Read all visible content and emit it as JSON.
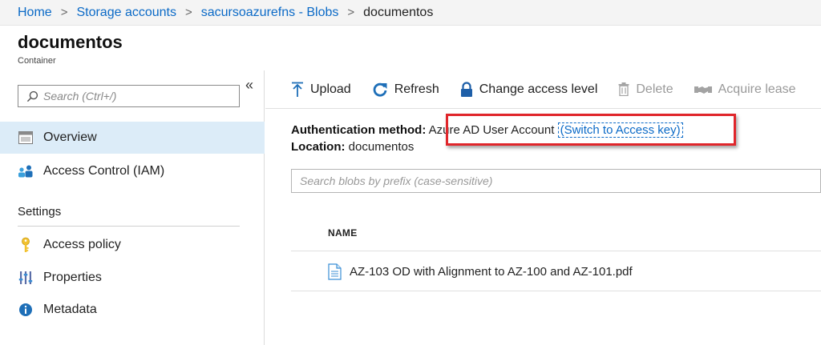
{
  "breadcrumb": {
    "items": [
      "Home",
      "Storage accounts",
      "sacursoazurefns - Blobs"
    ],
    "current": "documentos",
    "separator": ">"
  },
  "page": {
    "title": "documentos",
    "subtitle": "Container"
  },
  "sidebar": {
    "collapse_glyph": "«",
    "search_placeholder": "Search (Ctrl+/)",
    "items": [
      {
        "label": "Overview",
        "icon": "overview-icon",
        "active": true
      },
      {
        "label": "Access Control (IAM)",
        "icon": "iam-icon",
        "active": false
      }
    ],
    "settings_heading": "Settings",
    "settings_items": [
      {
        "label": "Access policy",
        "icon": "key-icon"
      },
      {
        "label": "Properties",
        "icon": "properties-icon"
      },
      {
        "label": "Metadata",
        "icon": "info-icon"
      }
    ]
  },
  "toolbar": {
    "upload": "Upload",
    "refresh": "Refresh",
    "change_access": "Change access level",
    "delete": "Delete",
    "acquire_lease": "Acquire lease"
  },
  "info": {
    "auth_label": "Authentication method:",
    "auth_value": "Azure AD User Account",
    "switch_link": "(Switch to Access key)",
    "location_label": "Location:",
    "location_value": "documentos"
  },
  "blob_search": {
    "placeholder": "Search blobs by prefix (case-sensitive)"
  },
  "table": {
    "header": "NAME",
    "rows": [
      {
        "name": "AZ-103 OD with Alignment to AZ-100 and AZ-101.pdf",
        "icon": "file-icon"
      }
    ]
  },
  "colors": {
    "accent": "#0b6ac7",
    "active_nav": "#dcecf8",
    "highlight": "#e0262b"
  }
}
